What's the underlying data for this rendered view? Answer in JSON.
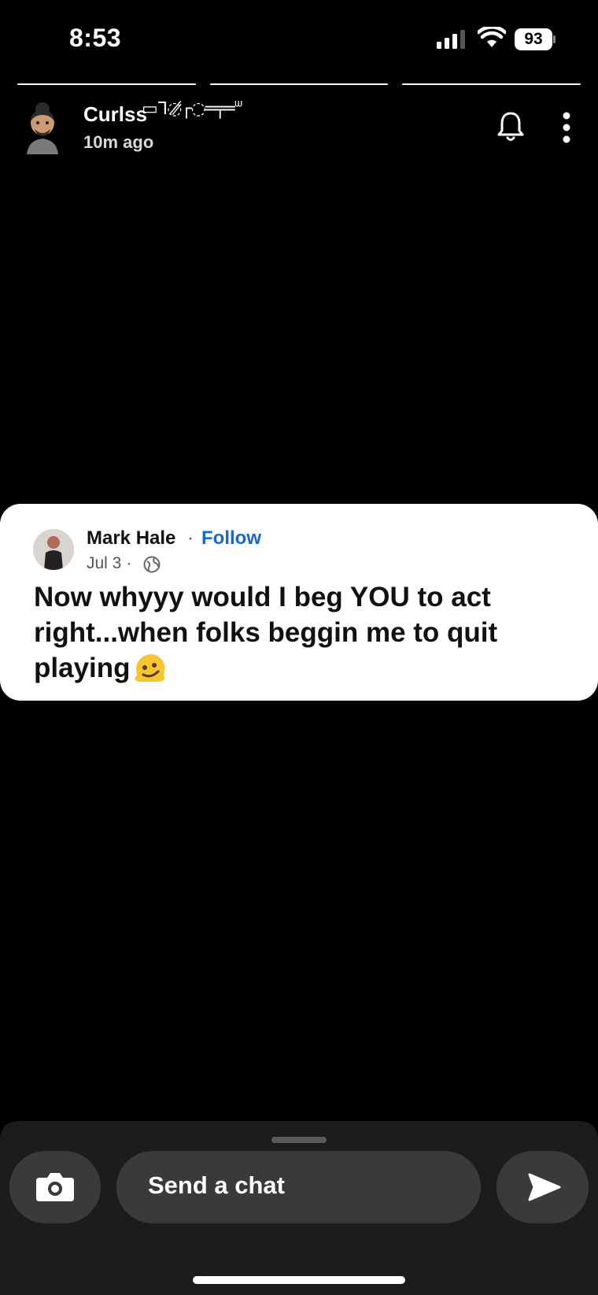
{
  "status": {
    "time": "8:53",
    "battery": "93"
  },
  "story": {
    "segments": 3,
    "author_name": "Curlss",
    "author_decoration": "▭ᒣ◌̸̷┌◌═╤═ᐜ",
    "posted": "10m ago",
    "icons": [
      "bell-icon",
      "more-vertical-icon"
    ]
  },
  "post": {
    "author": "Mark Hale",
    "separator": "·",
    "follow_label": "Follow",
    "date": "Jul 3 ·",
    "text": "Now whyyy would I beg YOU to act right...when folks beggin me to quit playing",
    "emoji": "melting-face-emoji",
    "colors": {
      "follow": "#1768c9",
      "card": "#ffffff"
    }
  },
  "chat": {
    "placeholder": "Send a chat",
    "icons": [
      "camera-icon",
      "send-icon"
    ]
  }
}
